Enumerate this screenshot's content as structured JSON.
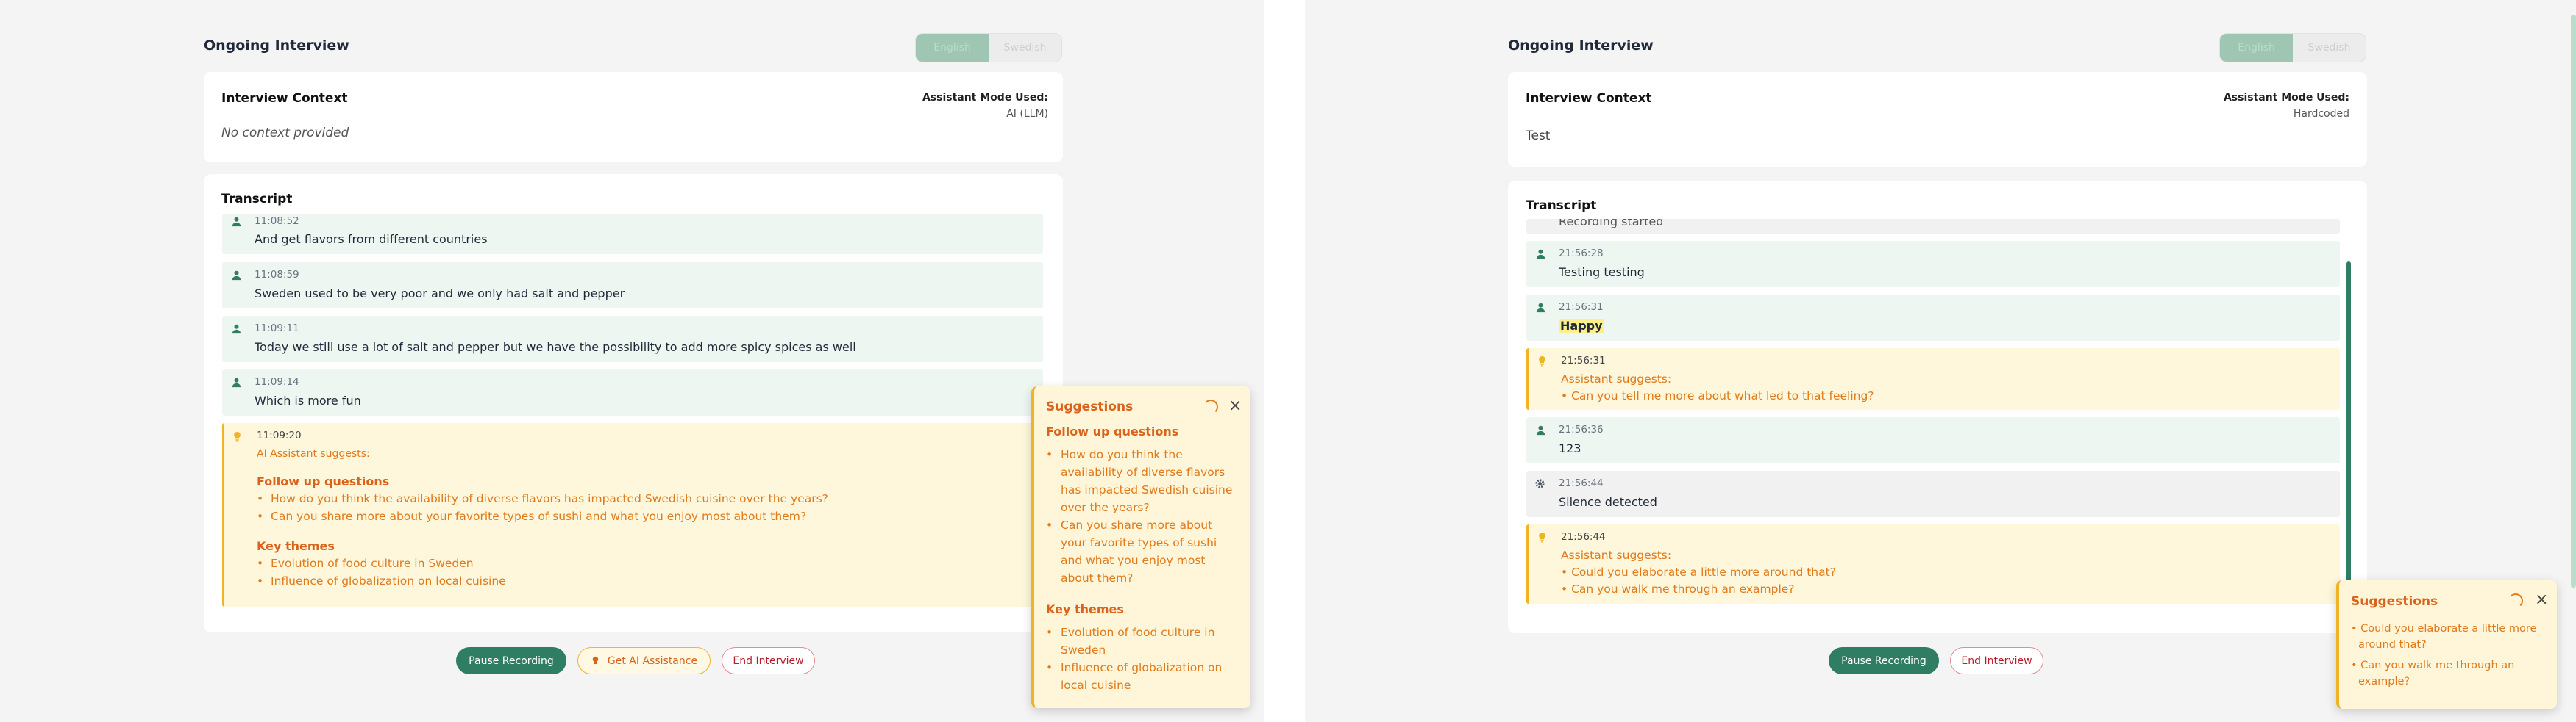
{
  "left": {
    "title": "Ongoing Interview",
    "lang_toggle": [
      "English",
      "Swedish"
    ],
    "context": {
      "heading": "Interview Context",
      "text": "No context provided",
      "mode_label": "Assistant Mode Used:",
      "mode_value": "AI (LLM)"
    },
    "transcript": {
      "heading": "Transcript",
      "entries": [
        {
          "time": "11:08:52",
          "text": "And get flavors from different countries"
        },
        {
          "time": "11:08:59",
          "text": "Sweden used to be very poor and we only had salt and pepper"
        },
        {
          "time": "11:09:11",
          "text": "Today we still use a lot of salt and pepper but we have the possibility to add more spicy spices as well"
        },
        {
          "time": "11:09:14",
          "text": "Which is more fun"
        }
      ],
      "suggestion": {
        "time": "11:09:20",
        "label": "AI Assistant suggests:",
        "followup_heading": "Follow up questions",
        "followups": [
          "How do you think the availability of diverse flavors has impacted Swedish cuisine over the years?",
          "Can you share more about your favorite types of sushi and what you enjoy most about them?"
        ],
        "themes_heading": "Key themes",
        "themes": [
          "Evolution of food culture in Sweden",
          "Influence of globalization on local cuisine"
        ]
      }
    },
    "buttons": {
      "pause": "Pause Recording",
      "assist": "Get AI Assistance",
      "end": "End Interview"
    },
    "popup": {
      "title": "Suggestions",
      "followup_heading": "Follow up questions",
      "followup_lines": [
        [
          "How do you think the",
          "availability of diverse flavors",
          "has impacted Swedish cuisine",
          "over the years?"
        ],
        [
          "Can you share more about",
          "your favorite types of sushi",
          "and what you enjoy most",
          "about them?"
        ]
      ],
      "themes_heading": "Key themes",
      "theme_lines": [
        [
          "Evolution of food culture in",
          "Sweden"
        ],
        [
          "Influence of globalization on",
          "local cuisine"
        ]
      ]
    }
  },
  "right": {
    "title": "Ongoing Interview",
    "lang_toggle": [
      "English",
      "Swedish"
    ],
    "context": {
      "heading": "Interview Context",
      "text": "Test",
      "mode_label": "Assistant Mode Used:",
      "mode_value": "Hardcoded"
    },
    "transcript": {
      "heading": "Transcript",
      "cut_text": "Recording started",
      "entries": [
        {
          "kind": "user",
          "time": "21:56:28",
          "text": "Testing testing"
        },
        {
          "kind": "user",
          "time": "21:56:31",
          "text": "Happy"
        },
        {
          "kind": "sug",
          "time": "21:56:31",
          "label": "Assistant suggests:",
          "lines": [
            "• Can you tell me more about what led to that feeling?"
          ]
        },
        {
          "kind": "user",
          "time": "21:56:36",
          "text": "123"
        },
        {
          "kind": "sys",
          "time": "21:56:44",
          "text": "Silence detected"
        },
        {
          "kind": "sug",
          "time": "21:56:44",
          "label": "Assistant suggests:",
          "lines": [
            "• Could you elaborate a little more around that?",
            "• Can you walk me through an example?"
          ]
        }
      ]
    },
    "buttons": {
      "pause": "Pause Recording",
      "end": "End Interview"
    },
    "popup": {
      "title": "Suggestions",
      "item1": [
        "• Could you elaborate a little more",
        "around that?"
      ],
      "item2": [
        "• Can you walk me through an",
        "example?"
      ]
    }
  },
  "colors": {
    "accent": "#2f7d63",
    "suggestion": "#e07a1b",
    "danger": "#b91c2c"
  }
}
